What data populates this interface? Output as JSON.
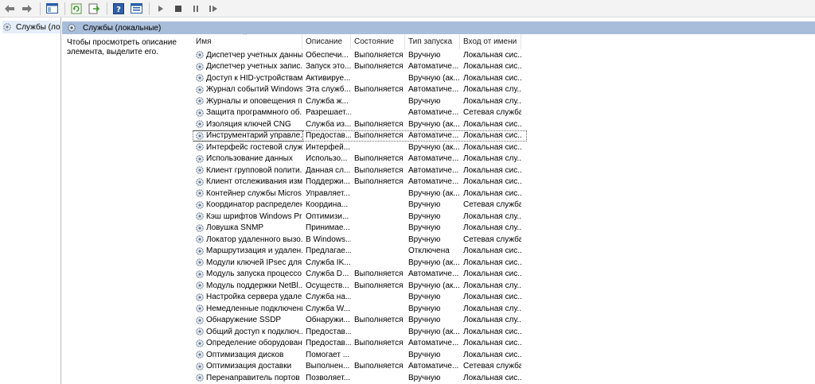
{
  "toolbar": {
    "buttons": [
      "back-icon",
      "forward-icon",
      "console-tree-icon",
      "refresh-icon",
      "export-list-icon",
      "help-icon",
      "properties-icon",
      "play-icon",
      "stop-icon",
      "pause-icon",
      "restart-icon"
    ]
  },
  "tree": {
    "item_label": "Службы (лока"
  },
  "panel": {
    "title": "Службы (локальные)",
    "description": "Чтобы просмотреть описание элемента, выделите его."
  },
  "columns": {
    "name": "Имя",
    "description": "Описание",
    "state": "Состояние",
    "startup": "Тип запуска",
    "logon": "Вход от имени"
  },
  "rows": [
    {
      "name": "Диспетчер учетных данных",
      "description": "Обеспечи...",
      "state": "Выполняется",
      "startup": "Вручную",
      "logon": "Локальная сис..."
    },
    {
      "name": "Диспетчер учетных запис...",
      "description": "Запуск это...",
      "state": "Выполняется",
      "startup": "Автоматиче...",
      "logon": "Локальная сис..."
    },
    {
      "name": "Доступ к HID-устройствам",
      "description": "Активируе...",
      "state": "",
      "startup": "Вручную (ак...",
      "logon": "Локальная сис..."
    },
    {
      "name": "Журнал событий Windows",
      "description": "Эта служб...",
      "state": "Выполняется",
      "startup": "Автоматиче...",
      "logon": "Локальная слу..."
    },
    {
      "name": "Журналы и оповещения п...",
      "description": "Служба ж...",
      "state": "",
      "startup": "Вручную",
      "logon": "Локальная слу..."
    },
    {
      "name": "Защита программного об...",
      "description": "Разрешает...",
      "state": "",
      "startup": "Автоматиче...",
      "logon": "Сетевая служба"
    },
    {
      "name": "Изоляция ключей CNG",
      "description": "Служба из...",
      "state": "Выполняется",
      "startup": "Вручную (ак...",
      "logon": "Локальная сис..."
    },
    {
      "name": "Инструментарий управле...",
      "description": "Предостав...",
      "state": "Выполняется",
      "startup": "Автоматиче...",
      "logon": "Локальная сис..."
    },
    {
      "name": "Интерфейс гостевой служ...",
      "description": "Интерфей...",
      "state": "",
      "startup": "Вручную (ак...",
      "logon": "Локальная сис..."
    },
    {
      "name": "Использование данных",
      "description": "Использо...",
      "state": "Выполняется",
      "startup": "Автоматиче...",
      "logon": "Локальная слу..."
    },
    {
      "name": "Клиент групповой полити...",
      "description": "Данная сл...",
      "state": "Выполняется",
      "startup": "Автоматиче...",
      "logon": "Локальная сис..."
    },
    {
      "name": "Клиент отслеживания изм...",
      "description": "Поддержи...",
      "state": "Выполняется",
      "startup": "Автоматиче...",
      "logon": "Локальная сис..."
    },
    {
      "name": "Контейнер службы Micros...",
      "description": "Управляет...",
      "state": "",
      "startup": "Вручную (ак...",
      "logon": "Локальная сис..."
    },
    {
      "name": "Координатор распределен...",
      "description": "Координа...",
      "state": "",
      "startup": "Вручную",
      "logon": "Сетевая служба"
    },
    {
      "name": "Кэш шрифтов Windows Pr...",
      "description": "Оптимизи...",
      "state": "",
      "startup": "Вручную",
      "logon": "Локальная слу..."
    },
    {
      "name": "Ловушка SNMP",
      "description": "Принимае...",
      "state": "",
      "startup": "Вручную",
      "logon": "Локальная слу..."
    },
    {
      "name": "Локатор удаленного вызо...",
      "description": "В Windows...",
      "state": "",
      "startup": "Вручную",
      "logon": "Сетевая служба"
    },
    {
      "name": "Маршрутизация и удален...",
      "description": "Предлагае...",
      "state": "",
      "startup": "Отключена",
      "logon": "Локальная сис..."
    },
    {
      "name": "Модули ключей IPsec для ...",
      "description": "Служба IK...",
      "state": "",
      "startup": "Вручную (ак...",
      "logon": "Локальная сис..."
    },
    {
      "name": "Модуль запуска процессо...",
      "description": "Служба D...",
      "state": "Выполняется",
      "startup": "Автоматиче...",
      "logon": "Локальная сис..."
    },
    {
      "name": "Модуль поддержки NetBl...",
      "description": "Осуществ...",
      "state": "Выполняется",
      "startup": "Вручную (ак...",
      "logon": "Локальная слу..."
    },
    {
      "name": "Настройка сервера удален...",
      "description": "Служба на...",
      "state": "",
      "startup": "Вручную",
      "logon": "Локальная сис..."
    },
    {
      "name": "Немедленные подключени...",
      "description": "Служба W...",
      "state": "",
      "startup": "Вручную",
      "logon": "Локальная слу..."
    },
    {
      "name": "Обнаружение SSDP",
      "description": "Обнаружи...",
      "state": "Выполняется",
      "startup": "Вручную",
      "logon": "Локальная слу..."
    },
    {
      "name": "Общий доступ к подключ...",
      "description": "Предостав...",
      "state": "",
      "startup": "Вручную (ак...",
      "logon": "Локальная сис..."
    },
    {
      "name": "Определение оборудован...",
      "description": "Предостав...",
      "state": "Выполняется",
      "startup": "Автоматиче...",
      "logon": "Локальная сис..."
    },
    {
      "name": "Оптимизация дисков",
      "description": "Помогает ...",
      "state": "",
      "startup": "Вручную",
      "logon": "Локальная сис..."
    },
    {
      "name": "Оптимизация доставки",
      "description": "Выполнен...",
      "state": "Выполняется",
      "startup": "Автоматиче...",
      "logon": "Сетевая служба"
    },
    {
      "name": "Перенаправитель портов ...",
      "description": "Позволяет...",
      "state": "",
      "startup": "Вручную",
      "logon": "Локальная сис..."
    }
  ],
  "focused_row": 7
}
